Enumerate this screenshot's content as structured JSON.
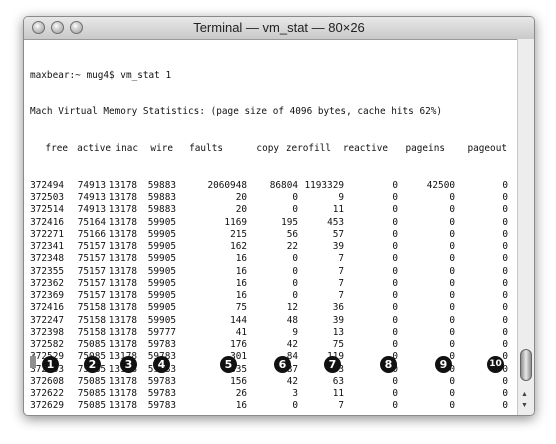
{
  "window": {
    "title": "Terminal — vm_stat — 80×26"
  },
  "prompt": "maxbear:~ mug4$ vm_stat 1",
  "banner": "Mach Virtual Memory Statistics: (page size of 4096 bytes, cache hits 62%)",
  "columns": [
    "free",
    "active",
    "inac",
    "wire",
    "faults",
    "copy",
    "zerofill",
    "reactive",
    "pageins",
    "pageout"
  ],
  "rows": [
    [
      "372494",
      "74913",
      "13178",
      "59883",
      "2060948",
      "86804",
      "1193329",
      "0",
      "42500",
      "0"
    ],
    [
      "372503",
      "74913",
      "13178",
      "59883",
      "20",
      "0",
      "9",
      "0",
      "0",
      "0"
    ],
    [
      "372514",
      "74913",
      "13178",
      "59883",
      "20",
      "0",
      "11",
      "0",
      "0",
      "0"
    ],
    [
      "372416",
      "75164",
      "13178",
      "59905",
      "1169",
      "195",
      "453",
      "0",
      "0",
      "0"
    ],
    [
      "372271",
      "75166",
      "13178",
      "59905",
      "215",
      "56",
      "57",
      "0",
      "0",
      "0"
    ],
    [
      "372341",
      "75157",
      "13178",
      "59905",
      "162",
      "22",
      "39",
      "0",
      "0",
      "0"
    ],
    [
      "372348",
      "75157",
      "13178",
      "59905",
      "16",
      "0",
      "7",
      "0",
      "0",
      "0"
    ],
    [
      "372355",
      "75157",
      "13178",
      "59905",
      "16",
      "0",
      "7",
      "0",
      "0",
      "0"
    ],
    [
      "372362",
      "75157",
      "13178",
      "59905",
      "16",
      "0",
      "7",
      "0",
      "0",
      "0"
    ],
    [
      "372369",
      "75157",
      "13178",
      "59905",
      "16",
      "0",
      "7",
      "0",
      "0",
      "0"
    ],
    [
      "372416",
      "75158",
      "13178",
      "59905",
      "75",
      "12",
      "36",
      "0",
      "0",
      "0"
    ],
    [
      "372247",
      "75158",
      "13178",
      "59905",
      "144",
      "48",
      "39",
      "0",
      "0",
      "0"
    ],
    [
      "372398",
      "75158",
      "13178",
      "59777",
      "41",
      "9",
      "13",
      "0",
      "0",
      "0"
    ],
    [
      "372582",
      "75085",
      "13178",
      "59783",
      "176",
      "42",
      "75",
      "0",
      "0",
      "0"
    ],
    [
      "372529",
      "75085",
      "13178",
      "59783",
      "301",
      "84",
      "119",
      "0",
      "0",
      "0"
    ],
    [
      "372503",
      "75085",
      "13178",
      "59783",
      "335",
      "87",
      "143",
      "0",
      "0",
      "0"
    ],
    [
      "372608",
      "75085",
      "13178",
      "59783",
      "156",
      "42",
      "63",
      "0",
      "0",
      "0"
    ],
    [
      "372622",
      "75085",
      "13178",
      "59783",
      "26",
      "3",
      "11",
      "0",
      "0",
      "0"
    ],
    [
      "372629",
      "75085",
      "13178",
      "59783",
      "16",
      "0",
      "7",
      "0",
      "0",
      "0"
    ]
  ],
  "callouts": [
    "1",
    "2",
    "3",
    "4",
    "5",
    "6",
    "7",
    "8",
    "9",
    "10"
  ]
}
